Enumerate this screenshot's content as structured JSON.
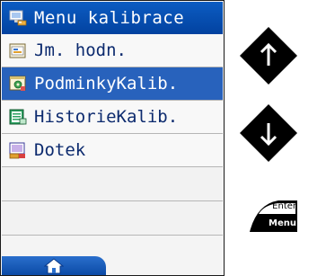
{
  "menu": {
    "title": "Menu kalibrace",
    "title_icon": "monitor-icon",
    "items": [
      {
        "label": "Jm. hodn.",
        "icon": "folder-icon",
        "selected": false
      },
      {
        "label": "PodminkyKalib.",
        "icon": "settings-window-icon",
        "selected": true
      },
      {
        "label": "HistorieKalib.",
        "icon": "history-list-icon",
        "selected": false
      },
      {
        "label": "Dotek",
        "icon": "touch-screen-icon",
        "selected": false
      }
    ],
    "empty_rows": 2,
    "footer_icon": "home-icon"
  },
  "controls": {
    "up_icon": "arrow-up-icon",
    "down_icon": "arrow-down-icon",
    "enter_label": "Enter",
    "menu_label": "Menu"
  },
  "colors": {
    "title_bar": "#0242a0",
    "selection": "#2862bc",
    "item_text": "#0c2a6e"
  }
}
